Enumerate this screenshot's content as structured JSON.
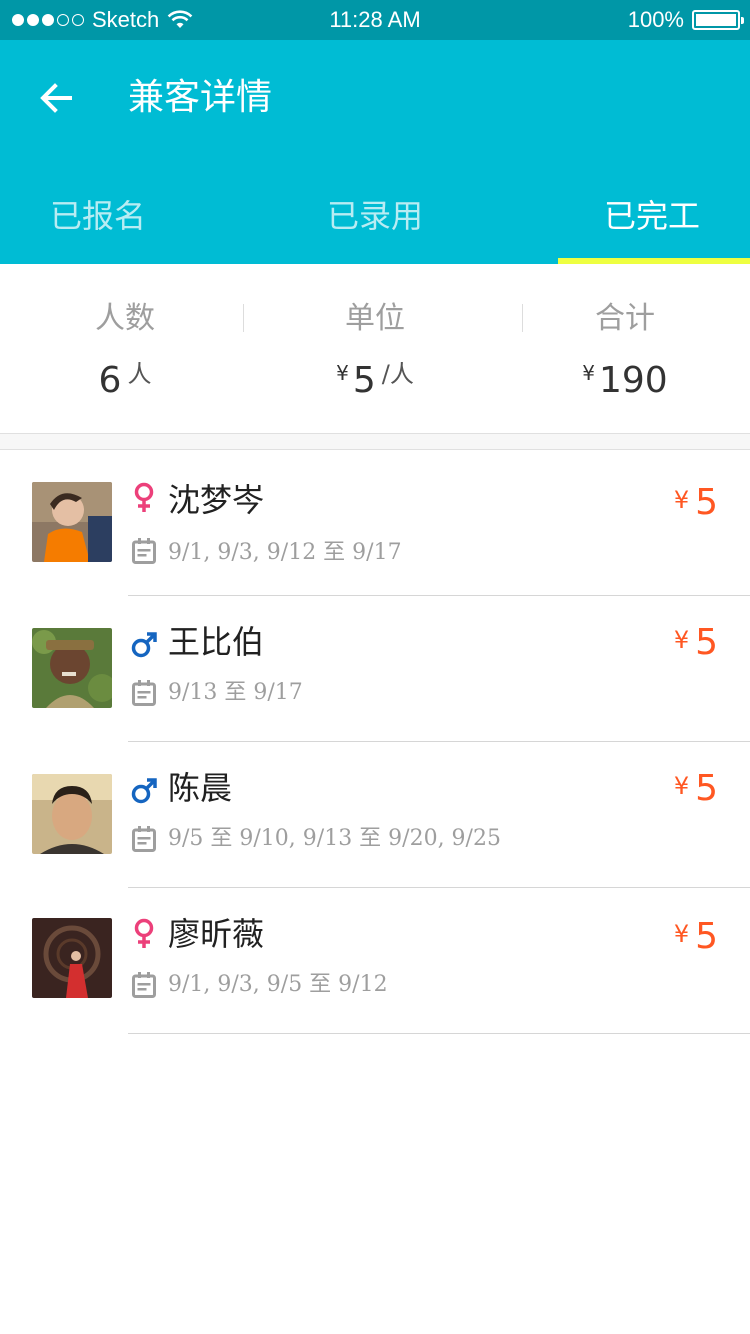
{
  "status_bar": {
    "carrier": "Sketch",
    "time": "11:28 AM",
    "battery": "100%",
    "signal_dots": [
      true,
      true,
      true,
      false,
      false
    ]
  },
  "header": {
    "title": "兼客详情",
    "back_icon": "arrow-left-icon",
    "tabs": [
      {
        "label": "已报名",
        "active": false
      },
      {
        "label": "已录用",
        "active": false
      },
      {
        "label": "已完工",
        "active": true
      }
    ]
  },
  "summary": {
    "count": {
      "label": "人数",
      "value": "6",
      "unit": "人"
    },
    "unit_price": {
      "label": "单位",
      "currency": "¥",
      "value": "5",
      "unit": "/人"
    },
    "total": {
      "label": "合计",
      "currency": "¥",
      "value": "190"
    }
  },
  "workers": [
    {
      "name": "沈梦岑",
      "gender": "female",
      "gender_symbol": "♀",
      "dates": "9/1, 9/3, 9/12 至 9/17",
      "currency": "¥",
      "amount": "5"
    },
    {
      "name": "王比伯",
      "gender": "male",
      "gender_symbol": "♂",
      "dates": "9/13 至 9/17",
      "currency": "¥",
      "amount": "5"
    },
    {
      "name": "陈晨",
      "gender": "male",
      "gender_symbol": "♂",
      "dates": "9/5 至 9/10, 9/13 至 9/20, 9/25",
      "currency": "¥",
      "amount": "5"
    },
    {
      "name": "廖昕薇",
      "gender": "female",
      "gender_symbol": "♀",
      "dates": "9/1, 9/3, 9/5 至 9/12",
      "currency": "¥",
      "amount": "5"
    }
  ],
  "colors": {
    "primary": "#00bcd4",
    "status_bar": "#0097a7",
    "tab_indicator": "#eeff41",
    "price": "#ff5722",
    "female": "#ec407a",
    "male": "#1565c0"
  }
}
